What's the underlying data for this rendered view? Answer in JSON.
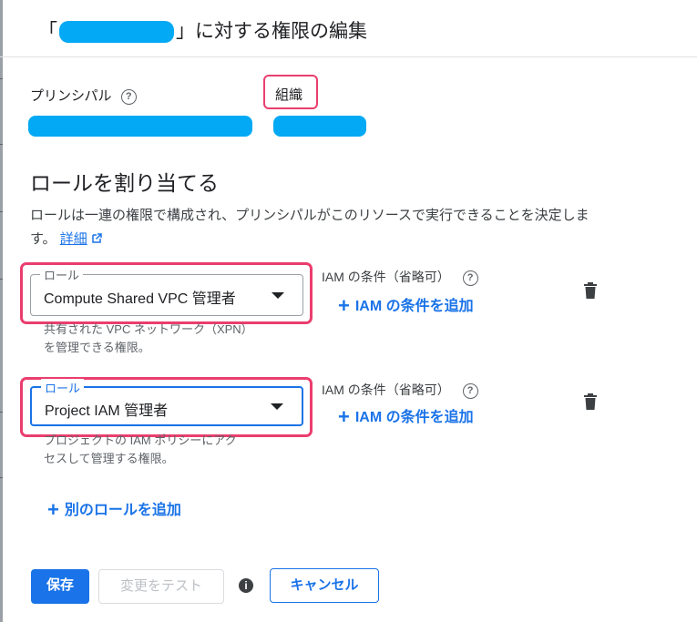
{
  "dialog": {
    "title_open_bracket": "「",
    "title_suffix": "」に対する権限の編集"
  },
  "principal": {
    "label": "プリンシパル",
    "help_icon": "help-circle-icon",
    "org_label": "組織"
  },
  "assign_roles": {
    "title": "ロールを割り当てる",
    "description": "ロールは一連の権限で構成され、プリンシパルがこのリソースで実行できることを決定します。",
    "learn_more": "詳細",
    "learn_more_icon": "external-link-icon"
  },
  "roles": [
    {
      "legend": "ロール",
      "value": "Compute Shared VPC 管理者",
      "helper_line1": "共有された VPC ネットワーク（XPN）",
      "helper_line2": "を管理できる権限。",
      "condition_label": "IAM の条件（省略可）",
      "add_condition": "IAM の条件を追加"
    },
    {
      "legend": "ロール",
      "value": "Project IAM 管理者",
      "helper_line1": "プロジェクトの IAM ポリシーにアク",
      "helper_line2": "セスして管理する権限。",
      "condition_label": "IAM の条件（省略可）",
      "add_condition": "IAM の条件を追加"
    }
  ],
  "add_role": "別のロールを追加",
  "footer": {
    "save": "保存",
    "test_changes": "変更をテスト",
    "cancel": "キャンセル"
  },
  "colors": {
    "primary": "#1a73e8",
    "highlight_annotation": "#ea3e6e",
    "redaction": "#03a9f4"
  }
}
